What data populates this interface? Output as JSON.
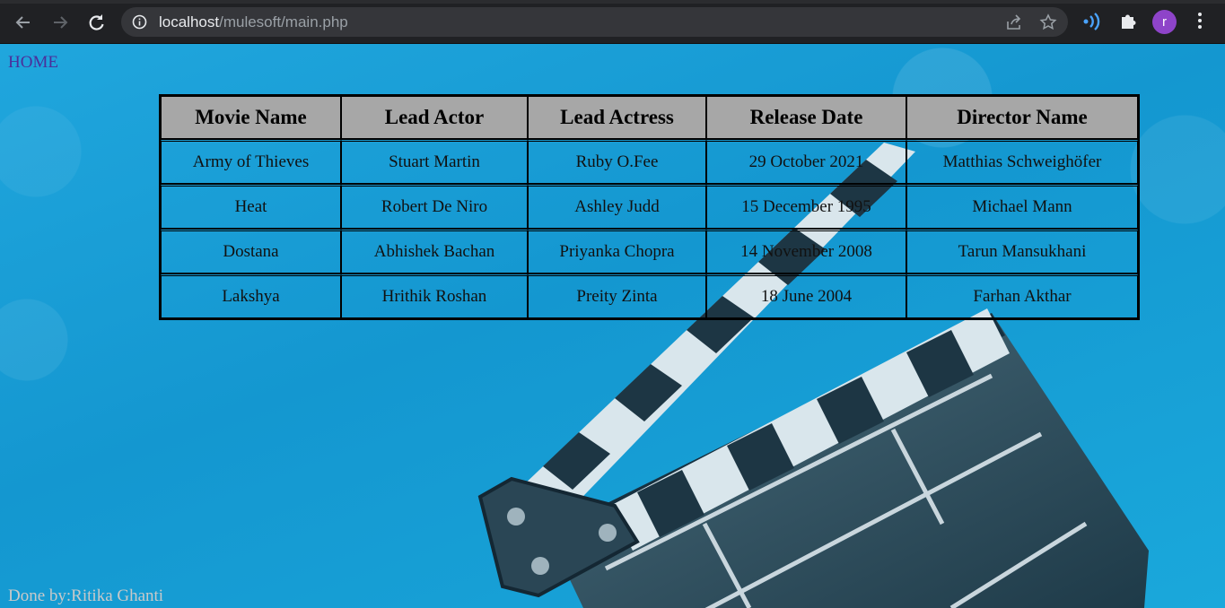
{
  "browser": {
    "url_host": "localhost",
    "url_path": "/mulesoft/main.php",
    "profile_initial": "r",
    "icons": [
      "back-icon",
      "forward-icon",
      "reload-icon",
      "info-icon",
      "share-icon",
      "star-icon",
      "extension-icon",
      "puzzle-icon",
      "menu-icon"
    ]
  },
  "page": {
    "home_link": "HOME",
    "credit": "Done by:Ritika Ghanti"
  },
  "table": {
    "headers": [
      "Movie Name",
      "Lead Actor",
      "Lead Actress",
      "Release Date",
      "Director Name"
    ],
    "rows": [
      [
        "Army of Thieves",
        "Stuart Martin",
        "Ruby O.Fee",
        "29 October 2021",
        "Matthias Schweighöfer"
      ],
      [
        "Heat",
        "Robert De Niro",
        "Ashley Judd",
        "15 December 1995",
        "Michael Mann"
      ],
      [
        "Dostana",
        "Abhishek Bachan",
        "Priyanka Chopra",
        "14 November 2008",
        "Tarun Mansukhani"
      ],
      [
        "Lakshya",
        "Hrithik Roshan",
        "Preity Zinta",
        "18 June 2004",
        "Farhan Akthar"
      ]
    ]
  },
  "colors": {
    "background": "#1aa3dc",
    "header_bg": "#a7a7a7",
    "link": "#4b2e9b",
    "credit": "#c9c9c9"
  }
}
